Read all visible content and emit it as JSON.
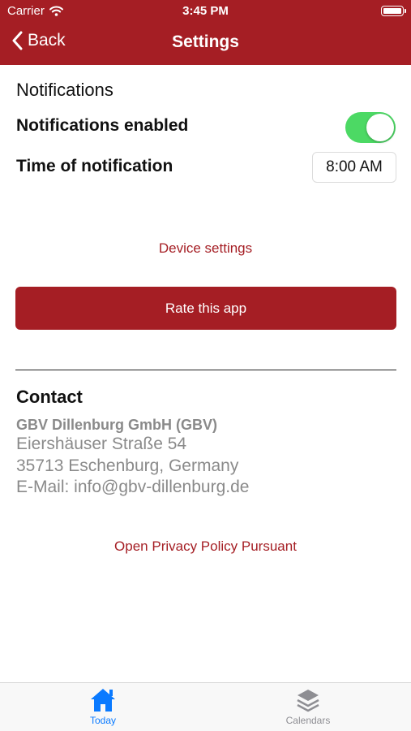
{
  "status_bar": {
    "carrier": "Carrier",
    "time": "3:45 PM"
  },
  "nav": {
    "back_label": "Back",
    "title": "Settings"
  },
  "notifications": {
    "section_title": "Notifications",
    "enabled_label": "Notifications enabled",
    "enabled": true,
    "time_label": "Time of notification",
    "time_value": "8:00 AM"
  },
  "actions": {
    "device_settings": "Device settings",
    "rate_app": "Rate this app"
  },
  "contact": {
    "title": "Contact",
    "company": "GBV Dillenburg GmbH (GBV)",
    "street": "Eiershäuser Straße 54",
    "city": "35713 Eschenburg, Germany",
    "email": "E-Mail: info@gbv-dillenburg.de"
  },
  "privacy_link": "Open Privacy Policy Pursuant",
  "tabs": [
    {
      "label": "Today",
      "icon": "home-icon",
      "active": true
    },
    {
      "label": "Calendars",
      "icon": "layers-icon",
      "active": false
    }
  ],
  "colors": {
    "brand": "#a51e24",
    "toggle_on": "#4cd964",
    "tab_active": "#0a7aff",
    "tab_inactive": "#8e8e93"
  }
}
